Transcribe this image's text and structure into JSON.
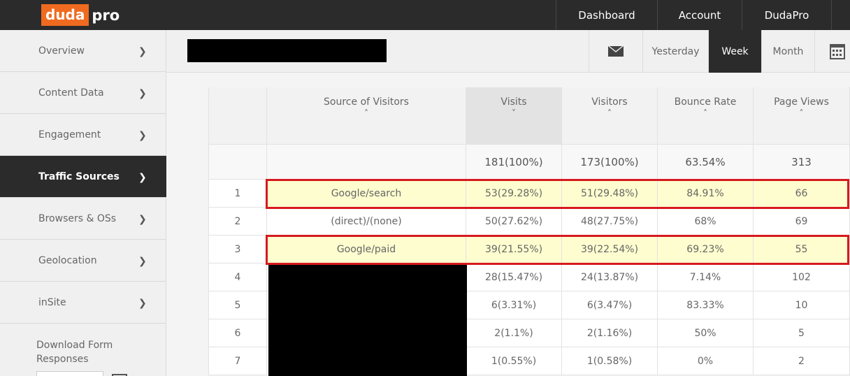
{
  "brand": {
    "logo_text": "duda",
    "logo_suffix": "pro",
    "accent_color": "#f06b1f"
  },
  "topnav": {
    "dashboard": "Dashboard",
    "account": "Account",
    "dudapro": "DudaPro"
  },
  "sidebar": {
    "items": [
      {
        "label": "Overview",
        "active": false
      },
      {
        "label": "Content Data",
        "active": false
      },
      {
        "label": "Engagement",
        "active": false
      },
      {
        "label": "Traffic Sources",
        "active": true
      },
      {
        "label": "Browsers & OSs",
        "active": false
      },
      {
        "label": "Geolocation",
        "active": false
      },
      {
        "label": "inSite",
        "active": false
      }
    ],
    "download_label": "Download Form Responses"
  },
  "header": {
    "range_buttons": {
      "yesterday": "Yesterday",
      "week": "Week",
      "month": "Month"
    },
    "selected_range": "Week"
  },
  "table": {
    "columns": [
      "Source of Visitors",
      "Visits",
      "Visitors",
      "Bounce Rate",
      "Page Views"
    ],
    "sorted_column": "Visits",
    "totals": {
      "visits": "181(100%)",
      "visitors": "173(100%)",
      "bounce_rate": "63.54%",
      "page_views": "313"
    },
    "rows": [
      {
        "rank": "1",
        "source": "Google/search",
        "visits": "53(29.28%)",
        "visitors": "51(29.48%)",
        "bounce_rate": "84.91%",
        "page_views": "66",
        "highlighted": true
      },
      {
        "rank": "2",
        "source": "(direct)/(none)",
        "visits": "50(27.62%)",
        "visitors": "48(27.75%)",
        "bounce_rate": "68%",
        "page_views": "69",
        "highlighted": false
      },
      {
        "rank": "3",
        "source": "Google/paid",
        "visits": "39(21.55%)",
        "visitors": "39(22.54%)",
        "bounce_rate": "69.23%",
        "page_views": "55",
        "highlighted": true
      },
      {
        "rank": "4",
        "source": "",
        "visits": "28(15.47%)",
        "visitors": "24(13.87%)",
        "bounce_rate": "7.14%",
        "page_views": "102",
        "highlighted": false
      },
      {
        "rank": "5",
        "source": "",
        "visits": "6(3.31%)",
        "visitors": "6(3.47%)",
        "bounce_rate": "83.33%",
        "page_views": "10",
        "highlighted": false
      },
      {
        "rank": "6",
        "source": "",
        "visits": "2(1.1%)",
        "visitors": "2(1.16%)",
        "bounce_rate": "50%",
        "page_views": "5",
        "highlighted": false
      },
      {
        "rank": "7",
        "source": "",
        "visits": "1(0.55%)",
        "visitors": "1(0.58%)",
        "bounce_rate": "0%",
        "page_views": "2",
        "highlighted": false
      }
    ]
  },
  "highlight_color": "#d7191f"
}
